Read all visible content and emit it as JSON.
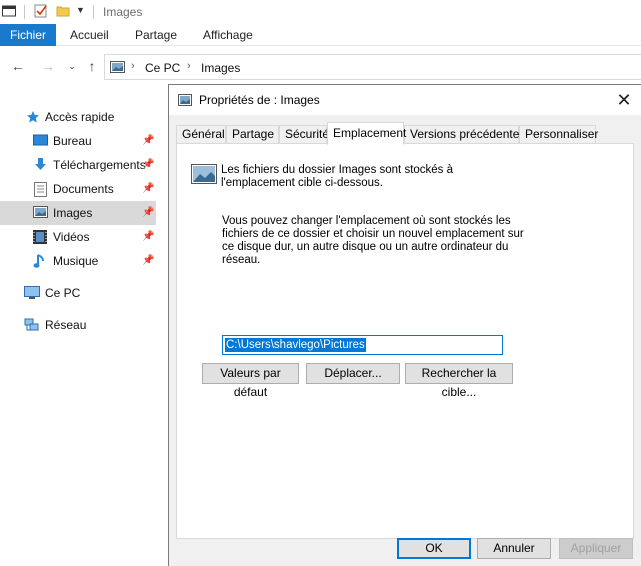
{
  "window": {
    "title": "Images"
  },
  "ribbon": {
    "tabs": [
      "Fichier",
      "Accueil",
      "Partage",
      "Affichage"
    ]
  },
  "address": {
    "crumbs": [
      "Ce PC",
      "Images"
    ]
  },
  "sidebar": {
    "items": [
      {
        "label": "Accès rapide",
        "icon": "star-icon"
      },
      {
        "label": "Bureau",
        "icon": "desktop-icon",
        "pinned": true
      },
      {
        "label": "Téléchargements",
        "icon": "download-icon",
        "pinned": true
      },
      {
        "label": "Documents",
        "icon": "document-icon",
        "pinned": true
      },
      {
        "label": "Images",
        "icon": "pictures-icon",
        "pinned": true,
        "selected": true
      },
      {
        "label": "Vidéos",
        "icon": "video-icon",
        "pinned": true
      },
      {
        "label": "Musique",
        "icon": "music-icon",
        "pinned": true
      },
      {
        "label": "Ce PC",
        "icon": "computer-icon"
      },
      {
        "label": "Réseau",
        "icon": "network-icon"
      }
    ]
  },
  "dialog": {
    "title": "Propriétés de : Images",
    "tabs": [
      "Général",
      "Partage",
      "Sécurité",
      "Emplacement",
      "Versions précédentes",
      "Personnaliser"
    ],
    "active_tab": "Emplacement",
    "info_line1": "Les fichiers du dossier Images sont stockés à",
    "info_line2": "l'emplacement cible ci-dessous.",
    "desc_line1": "Vous pouvez changer l'emplacement où sont stockés les",
    "desc_line2": "fichiers de ce dossier et choisir un nouvel emplacement sur",
    "desc_line3": "ce disque dur, un autre disque ou un autre ordinateur du",
    "desc_line4": "réseau.",
    "path_value": "C:\\Users\\shavlego\\Pictures",
    "buttons": {
      "default": "Valeurs par défaut",
      "move": "Déplacer...",
      "find": "Rechercher la cible...",
      "ok": "OK",
      "cancel": "Annuler",
      "apply": "Appliquer"
    }
  },
  "colors": {
    "accent": "#0078d7",
    "file_tab": "#1979ca",
    "selected_item": "#d9d9d9"
  }
}
